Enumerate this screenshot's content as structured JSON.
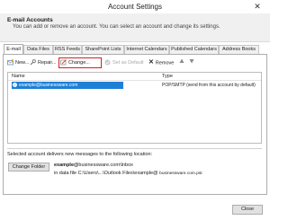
{
  "window": {
    "title": "Account Settings",
    "close_glyph": "✕"
  },
  "header": {
    "title": "E-mail Accounts",
    "description": "You can add or remove an account. You can select an account and change its settings."
  },
  "tabs": [
    "E-mail",
    "Data Files",
    "RSS Feeds",
    "SharePoint Lists",
    "Internet Calendars",
    "Published Calendars",
    "Address Books"
  ],
  "toolbar": {
    "new": "New...",
    "repair": "Repair...",
    "change": "Change...",
    "set_default": "Set as Default",
    "remove": "Remove",
    "highlight_color": "#d21f26"
  },
  "list": {
    "columns": {
      "name": "Name",
      "type": "Type"
    },
    "rows": [
      {
        "name": "example@businessware.com",
        "type": "POP/SMTP (send from this account by default)"
      }
    ],
    "selection_color": "#1e7fd6"
  },
  "delivery": {
    "label": "Selected account delivers new messages to the following location:",
    "change_folder": "Change Folder",
    "account": "example@",
    "account_sub": "businessware.com\\Inbox",
    "data_file_prefix": "in data file C:\\Users\\...\\Outlook Files\\example@",
    "data_file_name": "businessware.com.pst"
  },
  "footer": {
    "close": "Close"
  }
}
